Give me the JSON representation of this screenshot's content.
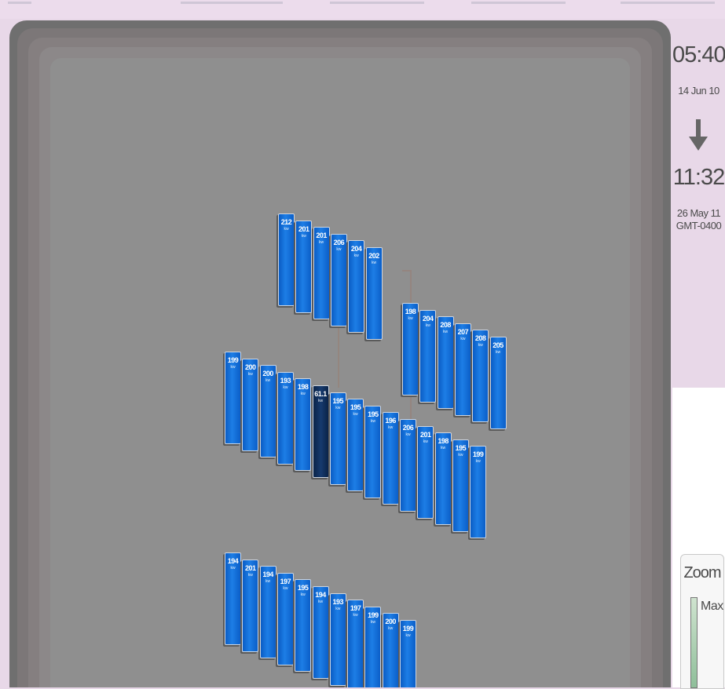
{
  "sidebar": {
    "start_time": "05:40",
    "start_date": "14 Jun 10",
    "end_time": "11:32",
    "end_date": "26 May 11",
    "timezone": "GMT-0400"
  },
  "zoom": {
    "title": "Zoom",
    "max_label": "Max"
  },
  "unit_label": "kw",
  "racks": [
    {
      "values": [
        "212",
        "201",
        "201",
        "206",
        "204",
        "202"
      ],
      "dark_index": -1
    },
    {
      "values": [
        "198",
        "204",
        "208",
        "207",
        "208",
        "205"
      ],
      "dark_index": -1
    },
    {
      "values": [
        "199",
        "200",
        "200",
        "193",
        "198",
        "61.1",
        "195",
        "195",
        "195",
        "196",
        "206",
        "201",
        "198",
        "195",
        "199"
      ],
      "dark_index": 5
    },
    {
      "values": [
        "194",
        "201",
        "194",
        "197",
        "195",
        "194",
        "193",
        "197",
        "199",
        "200",
        "199"
      ],
      "dark_index": -1
    }
  ],
  "colors": {
    "unit": "#1d7ee6",
    "unit_dark": "#163a6e",
    "floor": "#8f8f8f"
  }
}
